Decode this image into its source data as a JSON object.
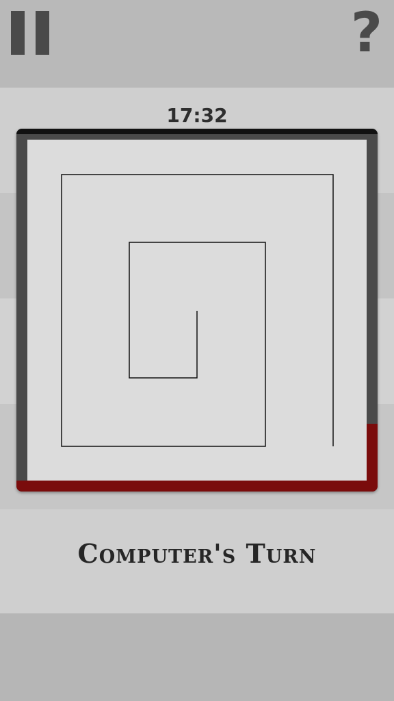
{
  "header": {
    "pause_icon": "pause-icon",
    "help_icon": "question-mark-icon",
    "help_label": "?"
  },
  "timer": {
    "time": "17:32"
  },
  "board": {
    "frame_color": "#4a4a4a",
    "field_color": "#dcdcdc",
    "progress_color": "#7a0c0c",
    "line_color": "#111111"
  },
  "status": {
    "turn_label": "Computer's Turn"
  }
}
